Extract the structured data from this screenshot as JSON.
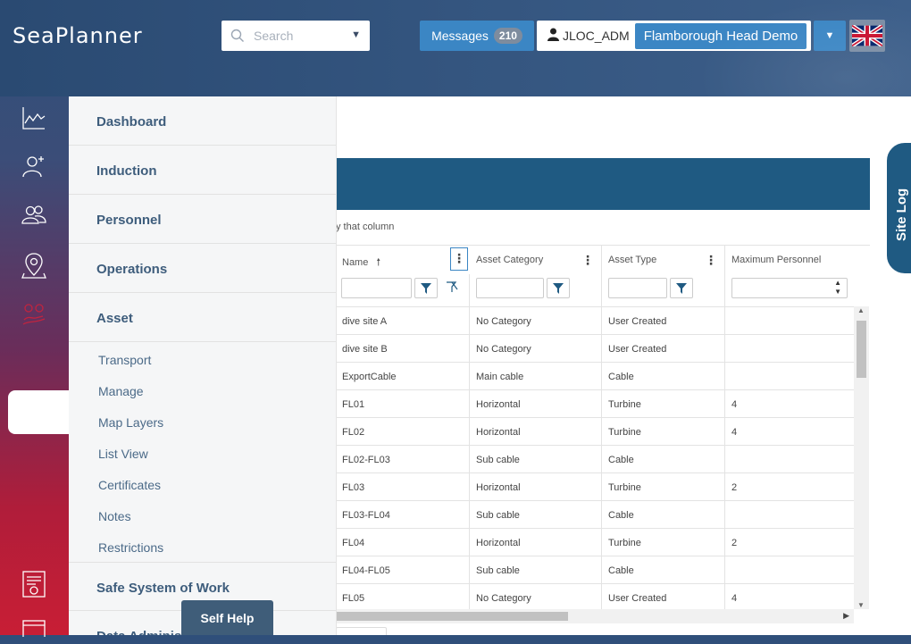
{
  "header": {
    "logo": "SeaPlanner",
    "search_placeholder": "Search",
    "messages_label": "Messages",
    "messages_count": "210",
    "username": "JLOC_ADM",
    "site_name": "Flamborough Head Demo"
  },
  "flyout": {
    "items": [
      {
        "label": "Dashboard"
      },
      {
        "label": "Induction"
      },
      {
        "label": "Personnel"
      },
      {
        "label": "Operations"
      },
      {
        "label": "Asset"
      }
    ],
    "asset_subitems": [
      {
        "label": "Transport"
      },
      {
        "label": "Manage"
      },
      {
        "label": "Map Layers"
      },
      {
        "label": "List View"
      },
      {
        "label": "Certificates"
      },
      {
        "label": "Notes"
      },
      {
        "label": "Restrictions"
      }
    ],
    "bottom_items": [
      {
        "label": "Safe System of Work"
      },
      {
        "label": "Data Administ"
      }
    ],
    "self_help": "Self Help"
  },
  "grid": {
    "group_hint": "y that column",
    "columns": [
      {
        "label": "Name"
      },
      {
        "label": "Asset Category"
      },
      {
        "label": "Asset Type"
      },
      {
        "label": "Maximum Personnel"
      }
    ],
    "rows": [
      [
        "dive site A",
        "No Category",
        "User Created",
        ""
      ],
      [
        "dive site B",
        "No Category",
        "User Created",
        ""
      ],
      [
        "ExportCable",
        "Main cable",
        "Cable",
        ""
      ],
      [
        "FL01",
        "Horizontal",
        "Turbine",
        "4"
      ],
      [
        "FL02",
        "Horizontal",
        "Turbine",
        "4"
      ],
      [
        "FL02-FL03",
        "Sub cable",
        "Cable",
        ""
      ],
      [
        "FL03",
        "Horizontal",
        "Turbine",
        "2"
      ],
      [
        "FL03-FL04",
        "Sub cable",
        "Cable",
        ""
      ],
      [
        "FL04",
        "Horizontal",
        "Turbine",
        "2"
      ],
      [
        "FL04-FL05",
        "Sub cable",
        "Cable",
        ""
      ],
      [
        "FL05",
        "No Category",
        "User Created",
        "4"
      ]
    ]
  },
  "site_log_label": "Site Log",
  "colors": {
    "accent_blue": "#3b86c4",
    "grid_header": "#1f5a82",
    "menu_text": "#3e5d7c"
  }
}
